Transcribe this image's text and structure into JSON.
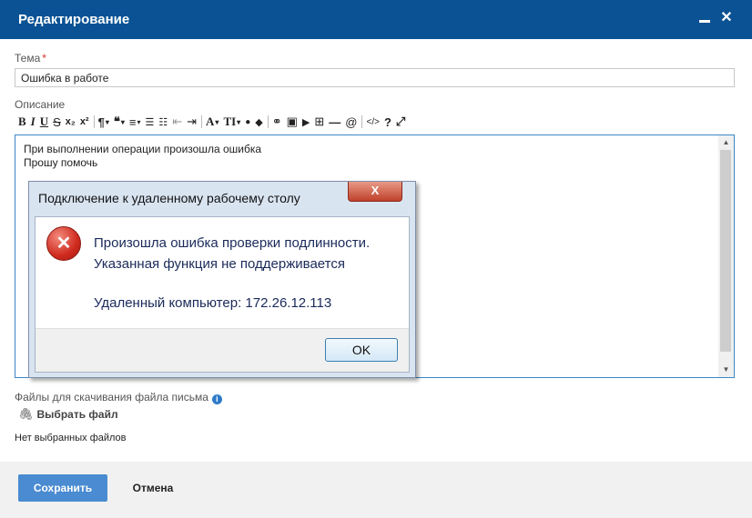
{
  "dialog": {
    "title": "Редактирование",
    "minimize_icon": "minimize-icon",
    "close_icon": "close-icon",
    "close_glyph": "✕"
  },
  "subject": {
    "label": "Тема",
    "required_mark": "*",
    "value": "Ошибка в работе"
  },
  "description": {
    "label": "Описание",
    "toolbar": [
      {
        "name": "bold-button",
        "glyph": "B"
      },
      {
        "name": "italic-button",
        "glyph": "I"
      },
      {
        "name": "underline-button",
        "glyph": "U"
      },
      {
        "name": "strikethrough-button",
        "glyph": "S"
      },
      {
        "name": "subscript-button",
        "glyph": "x₂"
      },
      {
        "name": "superscript-button",
        "glyph": "x²"
      },
      {
        "name": "paragraph-format-button",
        "glyph": "¶"
      },
      {
        "name": "quote-button",
        "glyph": "❝"
      },
      {
        "name": "align-button",
        "glyph": "≡"
      },
      {
        "name": "ordered-list-button",
        "glyph": "☰"
      },
      {
        "name": "unordered-list-button",
        "glyph": "☷"
      },
      {
        "name": "outdent-button",
        "glyph": "⇤"
      },
      {
        "name": "indent-button",
        "glyph": "⇥"
      },
      {
        "name": "font-color-button",
        "glyph": "A"
      },
      {
        "name": "font-size-button",
        "glyph": "TI"
      },
      {
        "name": "highlight-button",
        "glyph": "●"
      },
      {
        "name": "clear-format-button",
        "glyph": "◆"
      },
      {
        "name": "link-button",
        "glyph": "⚭"
      },
      {
        "name": "image-button",
        "glyph": "▣"
      },
      {
        "name": "video-button",
        "glyph": "▶"
      },
      {
        "name": "table-button",
        "glyph": "⊞"
      },
      {
        "name": "horizontal-line-button",
        "glyph": "—"
      },
      {
        "name": "mention-button",
        "glyph": "@"
      },
      {
        "name": "source-code-button",
        "glyph": "</>"
      },
      {
        "name": "help-button",
        "glyph": "?"
      },
      {
        "name": "fullscreen-button",
        "glyph": "⤢"
      }
    ],
    "lines": [
      "При выполнении операции произошла ошибка",
      "Прошу помочь"
    ],
    "screenshot": {
      "title": "Подключение к удаленному рабочему столу",
      "close_glyph": "X",
      "error_glyph": "✕",
      "message_line1": "Произошла ошибка проверки подлинности.",
      "message_line2": "Указанная функция не поддерживается",
      "message_line3": "Удаленный компьютер: 172.26.12.113",
      "ok_label": "OK"
    }
  },
  "attachments": {
    "label": "Файлы для скачивания файла письма",
    "info_glyph": "i",
    "choose_label": "Выбрать файл",
    "clip_glyph": "🖇",
    "empty_text": "Нет выбранных файлов"
  },
  "actions": {
    "save_label": "Сохранить",
    "cancel_label": "Отмена"
  }
}
